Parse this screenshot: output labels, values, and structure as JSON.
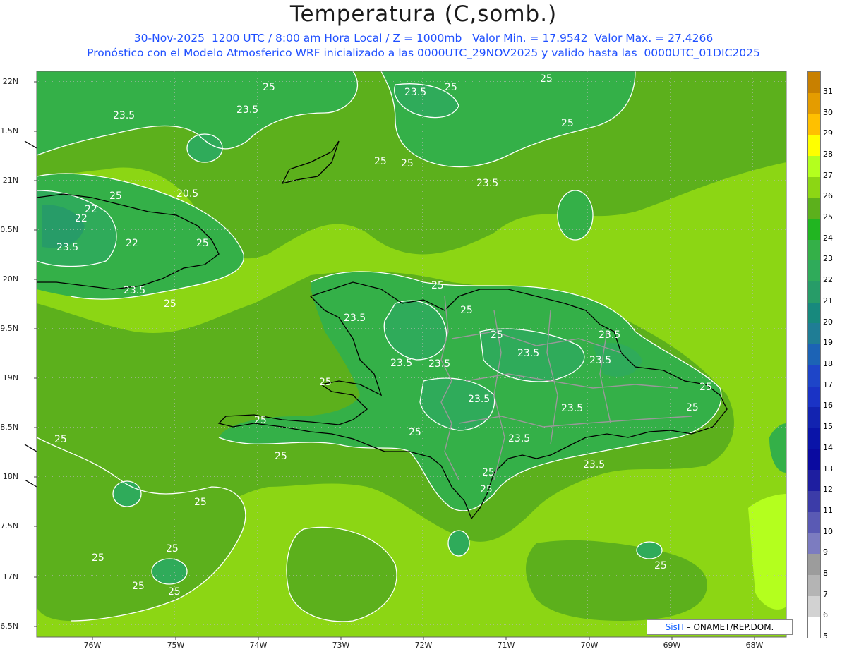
{
  "header": {
    "title": "Temperatura (C,somb.)",
    "line1": "30-Nov-2025  1200 UTC / 8:00 am Hora Local / Z = 1000mb   Valor Min. = 17.9542  Valor Max. = 27.4266",
    "line2": "Pronóstico con el Modelo Atmosferico WRF inicializado a las 0000UTC_29NOV2025 y valido hasta las  0000UTC_01DIC2025"
  },
  "axes": {
    "lat_labels": [
      "22N",
      "1.5N",
      "21N",
      "0.5N",
      "20N",
      "9.5N",
      "19N",
      "8.5N",
      "18N",
      "7.5N",
      "17N",
      "6.5N"
    ],
    "lon_labels": [
      "76W",
      "75W",
      "74W",
      "73W",
      "72W",
      "71W",
      "70W",
      "69W",
      "68W"
    ]
  },
  "contour_labels": [
    "23.5",
    "25",
    "23.5",
    "23.5",
    "25",
    "25",
    "25",
    "25",
    "25",
    "23.5",
    "25",
    "20.5",
    "22",
    "22",
    "22",
    "23.5",
    "25",
    "23.5",
    "25",
    "25",
    "23.5",
    "25",
    "23.5",
    "25",
    "23.5",
    "23.5",
    "23.5",
    "23.5",
    "25",
    "25",
    "23.5",
    "25",
    "23.5",
    "25",
    "23.5",
    "23.5",
    "25",
    "25",
    "25",
    "25",
    "25",
    "25",
    "25",
    "25",
    "25",
    "25",
    "25"
  ],
  "colorbar": {
    "labels": [
      "31",
      "30",
      "29",
      "28",
      "27",
      "26",
      "25",
      "24",
      "23",
      "22",
      "21",
      "20",
      "19",
      "18",
      "17",
      "16",
      "15",
      "14",
      "13",
      "12",
      "11",
      "10",
      "9",
      "8",
      "7",
      "6",
      "5"
    ],
    "colors": [
      "#c88000",
      "#e49c00",
      "#ffc000",
      "#ffff00",
      "#b4ff1e",
      "#8cd614",
      "#5cb01c",
      "#21b521",
      "#34b048",
      "#2fab5a",
      "#279c68",
      "#17897d",
      "#1f7d95",
      "#1c63b5",
      "#1e45c8",
      "#1a33c5",
      "#1223b0",
      "#0a14a8",
      "#0a0aa0",
      "#1e1ea0",
      "#3c3ca8",
      "#5a5ab4",
      "#7c7cc0",
      "#9c9c9c",
      "#b4b4b4",
      "#d2d2d2",
      "#ffffff"
    ]
  },
  "credit": {
    "brand": "SisΠ",
    "text": " – ONAMET/REP.DOM."
  }
}
